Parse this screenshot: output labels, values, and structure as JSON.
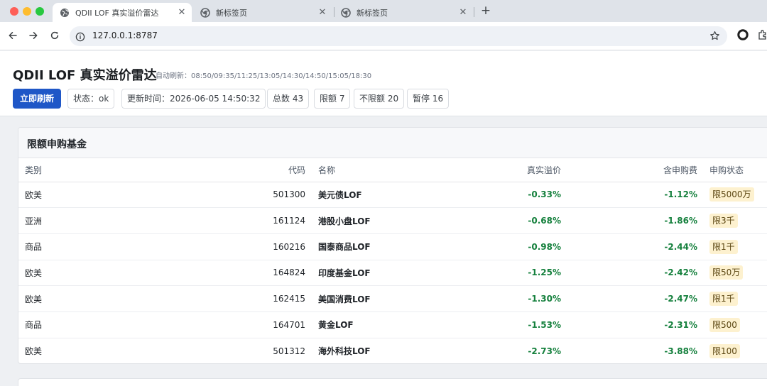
{
  "browser": {
    "tabs": [
      {
        "title": "QDII LOF 真实溢价雷达",
        "active": true
      },
      {
        "title": "新标签页",
        "active": false
      },
      {
        "title": "新标签页",
        "active": false
      }
    ],
    "url": "127.0.0.1:8787"
  },
  "header": {
    "title": "QDII LOF 真实溢价雷达",
    "auto_refresh": "自动刷新：08:50/09:35/11:25/13:05/14:30/14:50/15:05/18:30",
    "refresh_button": "立即刷新",
    "chips": {
      "status": "状态：ok",
      "updated": "更新时间：2026-06-05 14:50:32",
      "total": "总数 43",
      "limited": "限额 7",
      "unlimited": "不限额 20",
      "suspended": "暂停 16"
    }
  },
  "limited_section": {
    "title": "限额申购基金",
    "columns": {
      "type": "类别",
      "code": "代码",
      "name": "名称",
      "premium": "真实溢价",
      "fee_premium": "含申购费",
      "status": "申购状态"
    },
    "rows": [
      {
        "type": "欧美",
        "code": "501300",
        "name": "美元债LOF",
        "premium": "-0.33%",
        "fee_premium": "-1.12%",
        "status": "限5000万"
      },
      {
        "type": "亚洲",
        "code": "161124",
        "name": "港股小盘LOF",
        "premium": "-0.68%",
        "fee_premium": "-1.86%",
        "status": "限3千"
      },
      {
        "type": "商品",
        "code": "160216",
        "name": "国泰商品LOF",
        "premium": "-0.98%",
        "fee_premium": "-2.44%",
        "status": "限1千"
      },
      {
        "type": "欧美",
        "code": "164824",
        "name": "印度基金LOF",
        "premium": "-1.25%",
        "fee_premium": "-2.42%",
        "status": "限50万"
      },
      {
        "type": "欧美",
        "code": "162415",
        "name": "美国消费LOF",
        "premium": "-1.30%",
        "fee_premium": "-2.47%",
        "status": "限1千"
      },
      {
        "type": "商品",
        "code": "164701",
        "name": "黄金LOF",
        "premium": "-1.53%",
        "fee_premium": "-2.31%",
        "status": "限500"
      },
      {
        "type": "欧美",
        "code": "501312",
        "name": "海外科技LOF",
        "premium": "-2.73%",
        "fee_premium": "-3.88%",
        "status": "限100"
      }
    ]
  },
  "colors": {
    "accent": "#1f57c7",
    "negative_value": "#15803d",
    "badge_bg": "#fdf1cf"
  }
}
